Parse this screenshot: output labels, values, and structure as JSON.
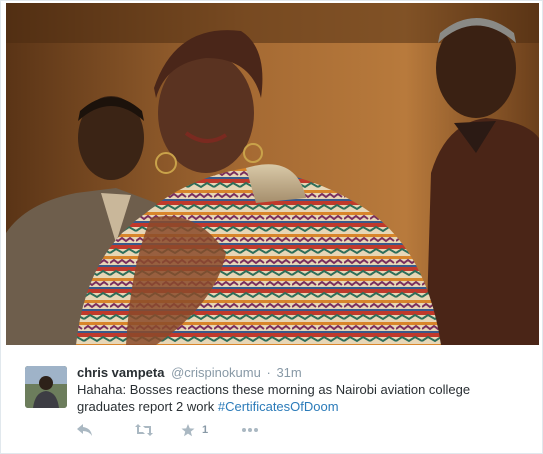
{
  "tweet": {
    "display_name": "chris vampeta",
    "handle": "@crispinokumu",
    "separator": "·",
    "time": "31m",
    "text": "Hahaha: Bosses reactions these morning as Nairobi aviation college graduates report 2 work ",
    "hashtag": "#CertificatesOfDoom",
    "favorite_count": "1"
  },
  "actions": {
    "reply_icon": "reply-icon",
    "retweet_icon": "retweet-icon",
    "favorite_icon": "star-icon",
    "more_icon": "more-icon"
  },
  "colors": {
    "name": "#292f33",
    "meta": "#8899a6",
    "hashtag": "#2b7bb9",
    "action_icons": "#aab8c2"
  }
}
